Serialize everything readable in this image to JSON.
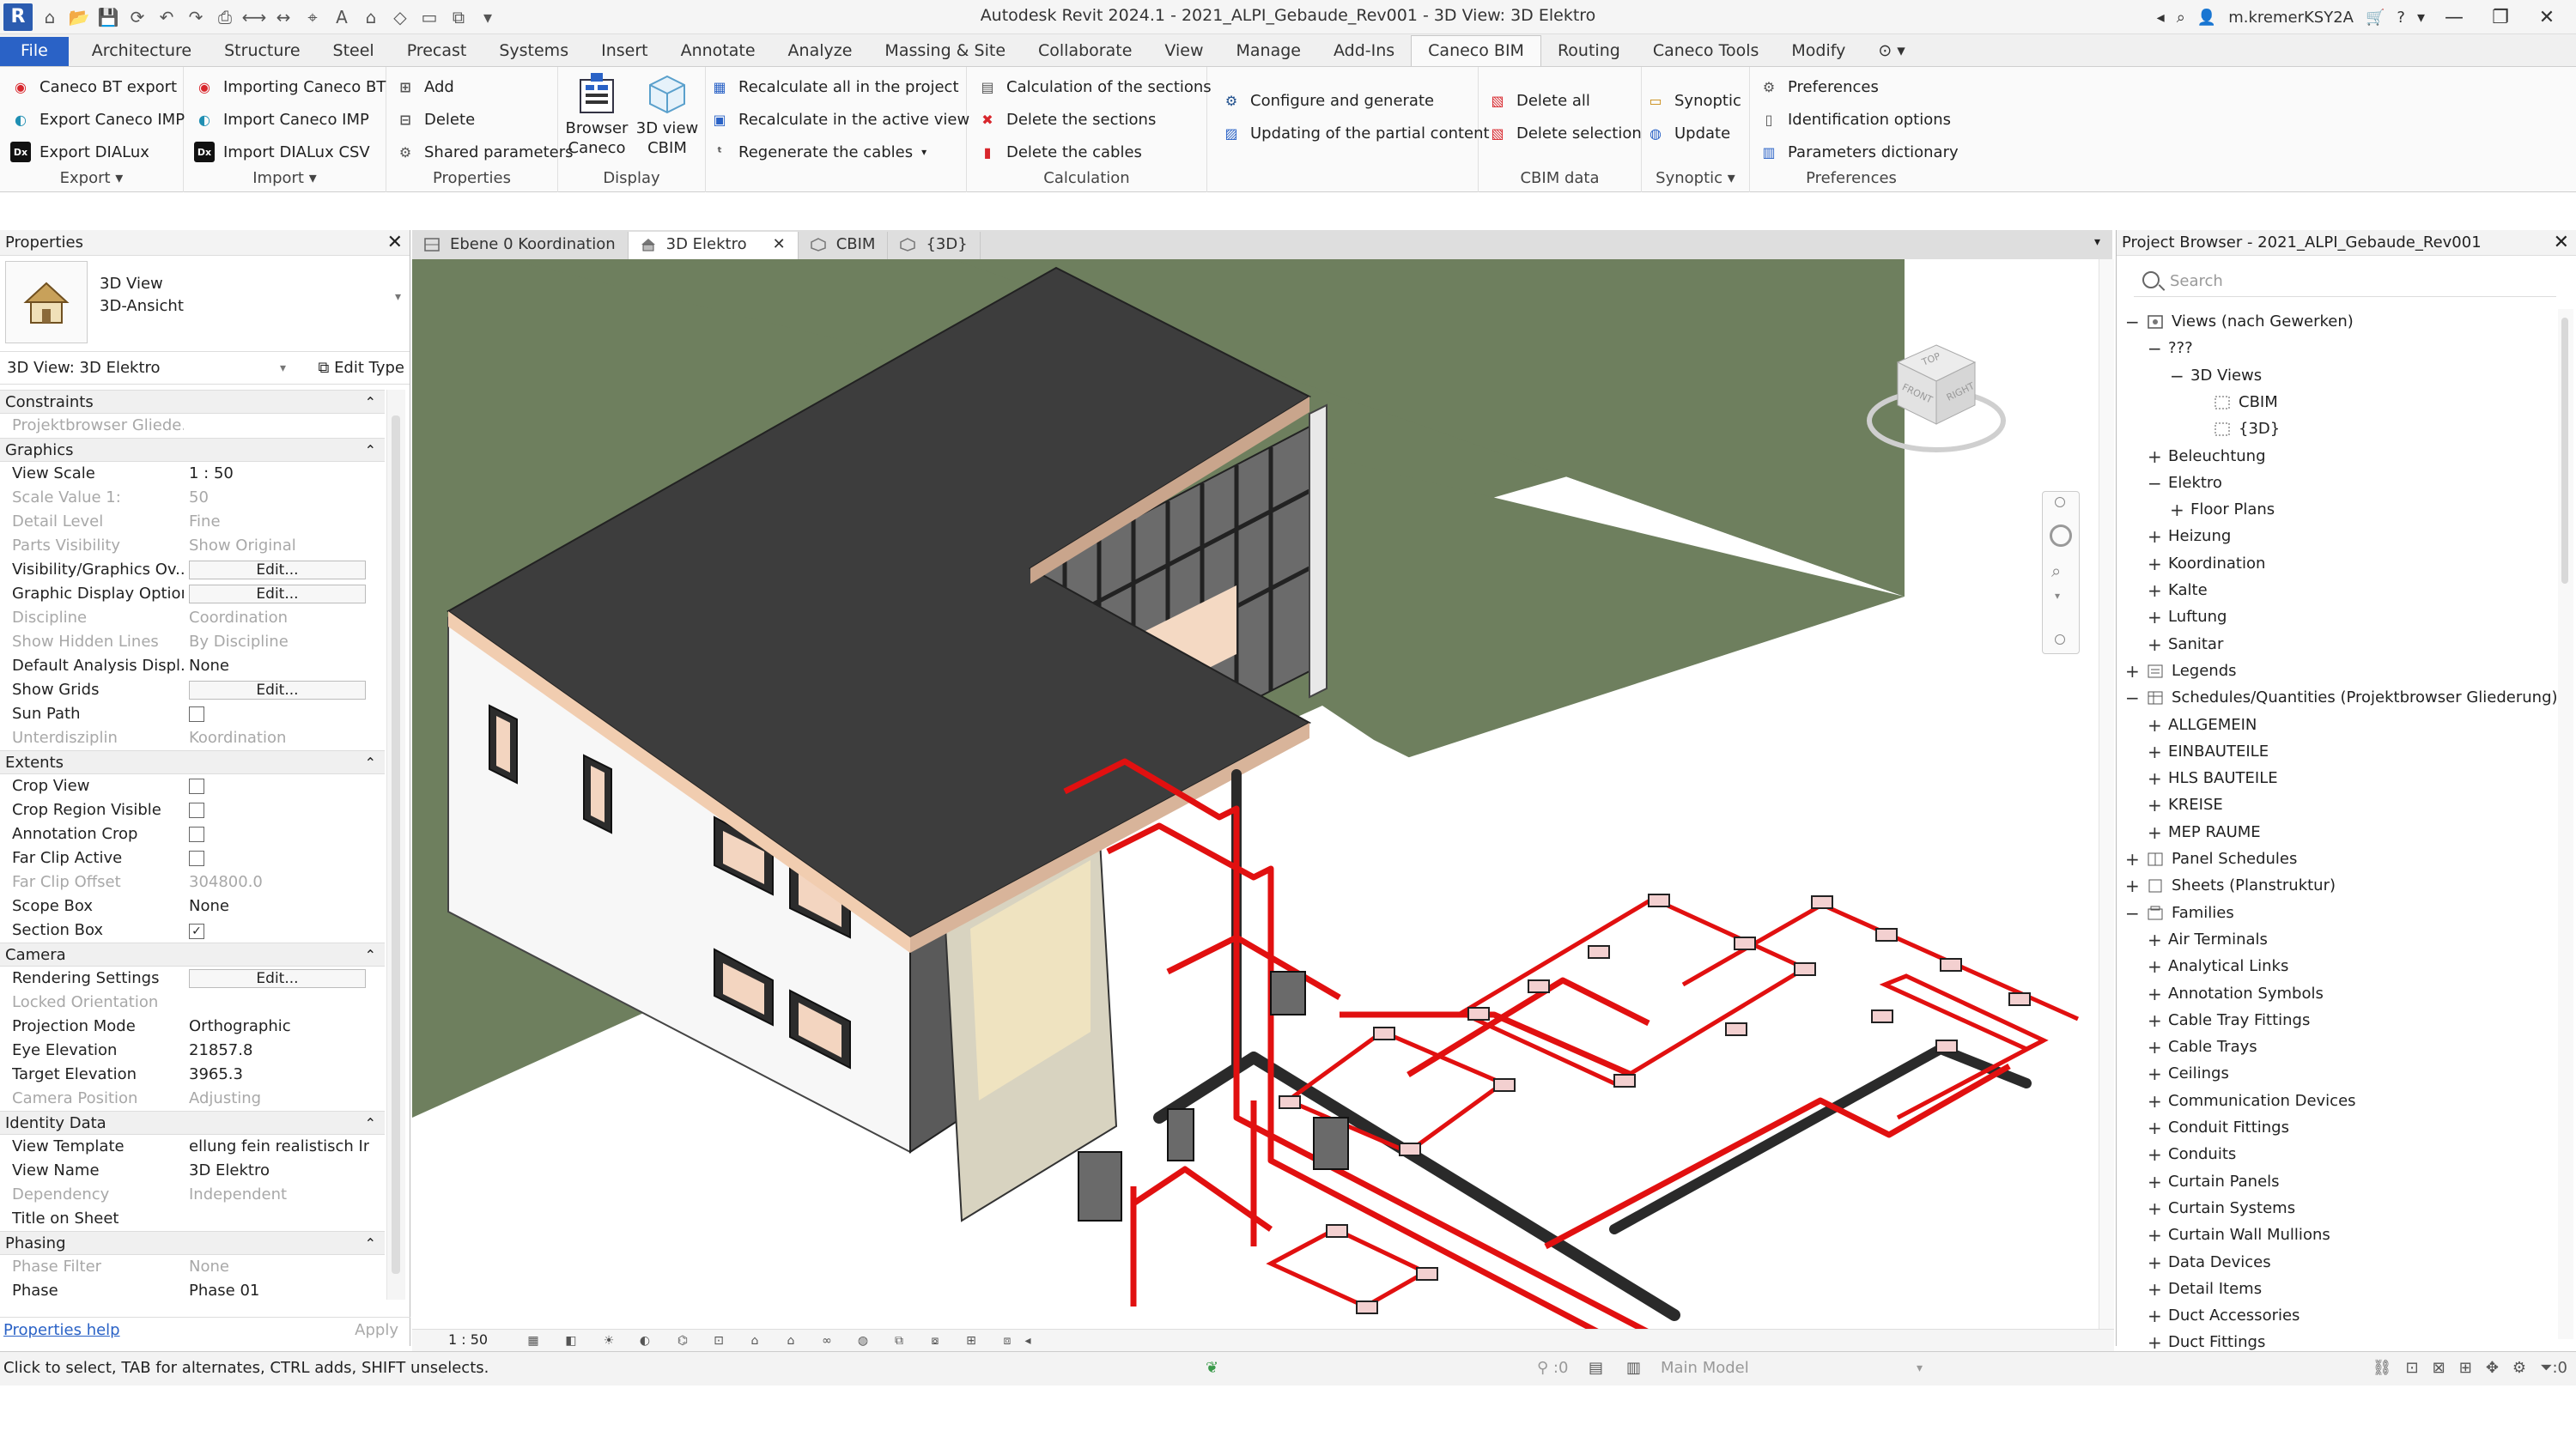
{
  "window": {
    "title": "Autodesk Revit 2024.1 - 2021_ALPI_Gebaude_Rev001 - 3D View: 3D Elektro",
    "user": "m.kremerKSY2A",
    "help": "?"
  },
  "ribbon_tabs": [
    "File",
    "Architecture",
    "Structure",
    "Steel",
    "Precast",
    "Systems",
    "Insert",
    "Annotate",
    "Analyze",
    "Massing & Site",
    "Collaborate",
    "View",
    "Manage",
    "Add-Ins",
    "Caneco BIM",
    "Routing",
    "Caneco Tools",
    "Modify"
  ],
  "active_tab": "Caneco BIM",
  "ribbon": {
    "export": {
      "label": "Export",
      "items": [
        "Caneco BT export",
        "Export Caneco IMP",
        "Export DIALux"
      ]
    },
    "import": {
      "label": "Import",
      "items": [
        "Importing Caneco BT",
        "Import Caneco IMP",
        "Import DIALux CSV"
      ]
    },
    "properties": {
      "label": "Properties",
      "items": [
        "Add",
        "Delete",
        "Shared parameters"
      ]
    },
    "display": {
      "label": "Display",
      "browser": "Browser Caneco",
      "view3d": "3D view CBIM"
    },
    "recalc": {
      "items": [
        "Recalculate all in the project",
        "Recalculate in the active view",
        "Regenerate the cables"
      ]
    },
    "calculation": {
      "label": "Calculation",
      "items": [
        "Calculation of the sections",
        "Delete the sections",
        "Delete the cables"
      ]
    },
    "configure": {
      "items": [
        "Configure and generate",
        "Updating of the partial content"
      ]
    },
    "cbim": {
      "label": "CBIM data",
      "items": [
        "Delete all",
        "Delete selection"
      ]
    },
    "synoptic": {
      "label": "Synoptic",
      "items": [
        "Synoptic",
        "Update"
      ]
    },
    "preferences": {
      "label": "Preferences",
      "items": [
        "Preferences",
        "Identification options",
        "Parameters dictionary"
      ]
    }
  },
  "properties": {
    "title": "Properties",
    "type_line1": "3D View",
    "type_line2": "3D-Ansicht",
    "selector": "3D View: 3D Elektro",
    "edit_type": "Edit Type",
    "sections": [
      {
        "name": "Constraints",
        "rows": [
          {
            "k": "Projektbrowser Gliede...",
            "v": "",
            "dis": true
          }
        ]
      },
      {
        "name": "Graphics",
        "rows": [
          {
            "k": "View Scale",
            "v": "1 : 50"
          },
          {
            "k": "Scale Value    1:",
            "v": "50",
            "dis": true
          },
          {
            "k": "Detail Level",
            "v": "Fine",
            "dis": true
          },
          {
            "k": "Parts Visibility",
            "v": "Show Original",
            "dis": true
          },
          {
            "k": "Visibility/Graphics Ov...",
            "v": "Edit...",
            "btn": true
          },
          {
            "k": "Graphic Display Options",
            "v": "Edit...",
            "btn": true
          },
          {
            "k": "Discipline",
            "v": "Coordination",
            "dis": true
          },
          {
            "k": "Show Hidden Lines",
            "v": "By Discipline",
            "dis": true
          },
          {
            "k": "Default Analysis Displ...",
            "v": "None"
          },
          {
            "k": "Show Grids",
            "v": "Edit...",
            "btn": true
          },
          {
            "k": "Sun Path",
            "v": "",
            "chk": "off"
          },
          {
            "k": "Unterdisziplin",
            "v": "Koordination",
            "dis": true
          }
        ]
      },
      {
        "name": "Extents",
        "rows": [
          {
            "k": "Crop View",
            "v": "",
            "chk": "off"
          },
          {
            "k": "Crop Region Visible",
            "v": "",
            "chk": "off"
          },
          {
            "k": "Annotation Crop",
            "v": "",
            "chk": "off"
          },
          {
            "k": "Far Clip Active",
            "v": "",
            "chk": "off"
          },
          {
            "k": "Far Clip Offset",
            "v": "304800.0",
            "dis": true
          },
          {
            "k": "Scope Box",
            "v": "None"
          },
          {
            "k": "Section Box",
            "v": "",
            "chk": "on"
          }
        ]
      },
      {
        "name": "Camera",
        "rows": [
          {
            "k": "Rendering Settings",
            "v": "Edit...",
            "btn": true
          },
          {
            "k": "Locked Orientation",
            "v": "",
            "dis": true
          },
          {
            "k": "Projection Mode",
            "v": "Orthographic"
          },
          {
            "k": "Eye Elevation",
            "v": "21857.8"
          },
          {
            "k": "Target Elevation",
            "v": "3965.3"
          },
          {
            "k": "Camera Position",
            "v": "Adjusting",
            "dis": true
          }
        ]
      },
      {
        "name": "Identity Data",
        "rows": [
          {
            "k": "View Template",
            "v": "ellung fein realistisch Inne"
          },
          {
            "k": "View Name",
            "v": "3D Elektro"
          },
          {
            "k": "Dependency",
            "v": "Independent",
            "dis": true
          },
          {
            "k": "Title on Sheet",
            "v": ""
          }
        ]
      },
      {
        "name": "Phasing",
        "rows": [
          {
            "k": "Phase Filter",
            "v": "None",
            "dis": true
          },
          {
            "k": "Phase",
            "v": "Phase 01"
          }
        ]
      }
    ],
    "help_link": "Properties help",
    "apply": "Apply"
  },
  "view_tabs": [
    {
      "label": "Ebene 0 Koordination",
      "active": false
    },
    {
      "label": "3D Elektro",
      "active": true
    },
    {
      "label": "CBIM",
      "active": false
    },
    {
      "label": "{3D}",
      "active": false
    }
  ],
  "view_controls": {
    "scale": "1 : 50"
  },
  "viewcube": {
    "top": "TOP",
    "front": "FRONT",
    "right": "RIGHT"
  },
  "project_browser": {
    "title": "Project Browser - 2021_ALPI_Gebaude_Rev001",
    "search_placeholder": "Search",
    "nodes": [
      {
        "label": "Views (nach Gewerken)",
        "depth": 0,
        "tog": "−",
        "icon": "views"
      },
      {
        "label": "???",
        "depth": 1,
        "tog": "−"
      },
      {
        "label": "3D Views",
        "depth": 2,
        "tog": "−"
      },
      {
        "label": "CBIM",
        "depth": 3,
        "tog": "",
        "icon": "view3d"
      },
      {
        "label": "{3D}",
        "depth": 3,
        "tog": "",
        "icon": "view3d"
      },
      {
        "label": "Beleuchtung",
        "depth": 1,
        "tog": "+"
      },
      {
        "label": "Elektro",
        "depth": 1,
        "tog": "−"
      },
      {
        "label": "Floor Plans",
        "depth": 2,
        "tog": "+"
      },
      {
        "label": "Heizung",
        "depth": 1,
        "tog": "+"
      },
      {
        "label": "Koordination",
        "depth": 1,
        "tog": "+"
      },
      {
        "label": "Kalte",
        "depth": 1,
        "tog": "+"
      },
      {
        "label": "Luftung",
        "depth": 1,
        "tog": "+"
      },
      {
        "label": "Sanitar",
        "depth": 1,
        "tog": "+"
      },
      {
        "label": "Legends",
        "depth": 0,
        "tog": "+",
        "icon": "legend"
      },
      {
        "label": "Schedules/Quantities (Projektbrowser Gliederung)",
        "depth": 0,
        "tog": "−",
        "icon": "schedule"
      },
      {
        "label": "ALLGEMEIN",
        "depth": 1,
        "tog": "+"
      },
      {
        "label": "EINBAUTEILE",
        "depth": 1,
        "tog": "+"
      },
      {
        "label": "HLS BAUTEILE",
        "depth": 1,
        "tog": "+"
      },
      {
        "label": "KREISE",
        "depth": 1,
        "tog": "+"
      },
      {
        "label": "MEP RAUME",
        "depth": 1,
        "tog": "+"
      },
      {
        "label": "Panel Schedules",
        "depth": 0,
        "tog": "+",
        "icon": "panel"
      },
      {
        "label": "Sheets (Planstruktur)",
        "depth": 0,
        "tog": "+",
        "icon": "sheet"
      },
      {
        "label": "Families",
        "depth": 0,
        "tog": "−",
        "icon": "family"
      },
      {
        "label": "Air Terminals",
        "depth": 1,
        "tog": "+"
      },
      {
        "label": "Analytical Links",
        "depth": 1,
        "tog": "+"
      },
      {
        "label": "Annotation Symbols",
        "depth": 1,
        "tog": "+"
      },
      {
        "label": "Cable Tray Fittings",
        "depth": 1,
        "tog": "+"
      },
      {
        "label": "Cable Trays",
        "depth": 1,
        "tog": "+"
      },
      {
        "label": "Ceilings",
        "depth": 1,
        "tog": "+"
      },
      {
        "label": "Communication Devices",
        "depth": 1,
        "tog": "+"
      },
      {
        "label": "Conduit Fittings",
        "depth": 1,
        "tog": "+"
      },
      {
        "label": "Conduits",
        "depth": 1,
        "tog": "+"
      },
      {
        "label": "Curtain Panels",
        "depth": 1,
        "tog": "+"
      },
      {
        "label": "Curtain Systems",
        "depth": 1,
        "tog": "+"
      },
      {
        "label": "Curtain Wall Mullions",
        "depth": 1,
        "tog": "+"
      },
      {
        "label": "Data Devices",
        "depth": 1,
        "tog": "+"
      },
      {
        "label": "Detail Items",
        "depth": 1,
        "tog": "+"
      },
      {
        "label": "Duct Accessories",
        "depth": 1,
        "tog": "+"
      },
      {
        "label": "Duct Fittings",
        "depth": 1,
        "tog": "+"
      }
    ]
  },
  "status": {
    "message": "Click to select, TAB for alternates, CTRL adds, SHIFT unselects.",
    "zero": ":0",
    "model": "Main Model",
    "filter": ":0"
  },
  "colors": {
    "ground": "#6e7f5e",
    "cable": "#e11010",
    "roof": "#3d3d3d",
    "accent": "#2a62c6"
  }
}
